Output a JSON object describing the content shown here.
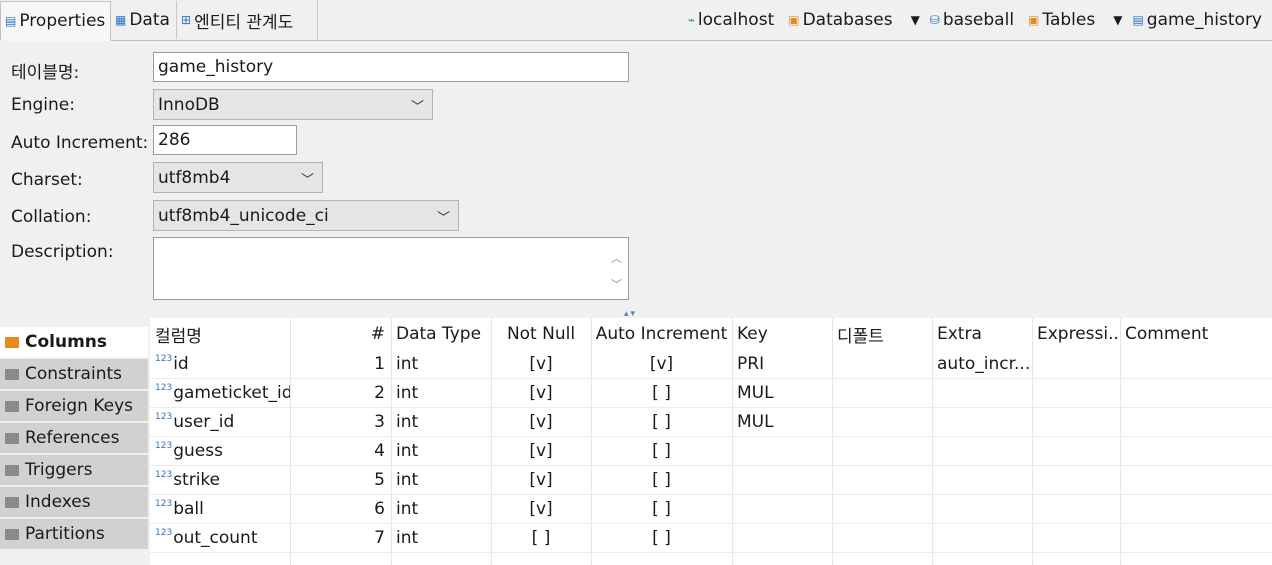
{
  "tabs": [
    {
      "label": "Properties",
      "icon": "properties-icon"
    },
    {
      "label": "Data",
      "icon": "data-icon"
    },
    {
      "label": "엔티티 관계도",
      "icon": "er-diagram-icon"
    }
  ],
  "breadcrumb": {
    "host": "localhost",
    "databases": "Databases",
    "database": "baseball",
    "tables": "Tables",
    "table": "game_history"
  },
  "form": {
    "table_name_label": "테이블명:",
    "table_name_value": "game_history",
    "engine_label": "Engine:",
    "engine_value": "InnoDB",
    "auto_increment_label": "Auto Increment:",
    "auto_increment_value": "286",
    "charset_label": "Charset:",
    "charset_value": "utf8mb4",
    "collation_label": "Collation:",
    "collation_value": "utf8mb4_unicode_ci",
    "description_label": "Description:",
    "description_value": ""
  },
  "sidenav": [
    "Columns",
    "Constraints",
    "Foreign Keys",
    "References",
    "Triggers",
    "Indexes",
    "Partitions"
  ],
  "columns_table": {
    "headers": [
      "컬럼명",
      "#",
      "Data Type",
      "Not Null",
      "Auto Increment",
      "Key",
      "디폴트",
      "Extra",
      "Expressi...",
      "Comment"
    ],
    "rows": [
      {
        "name": "id",
        "num": "1",
        "type": "int",
        "not_null": "[v]",
        "auto_inc": "[v]",
        "key": "PRI",
        "default": "",
        "extra": "auto_incr...",
        "expr": "",
        "comment": ""
      },
      {
        "name": "gameticket_id",
        "num": "2",
        "type": "int",
        "not_null": "[v]",
        "auto_inc": "[ ]",
        "key": "MUL",
        "default": "",
        "extra": "",
        "expr": "",
        "comment": ""
      },
      {
        "name": "user_id",
        "num": "3",
        "type": "int",
        "not_null": "[v]",
        "auto_inc": "[ ]",
        "key": "MUL",
        "default": "",
        "extra": "",
        "expr": "",
        "comment": ""
      },
      {
        "name": "guess",
        "num": "4",
        "type": "int",
        "not_null": "[v]",
        "auto_inc": "[ ]",
        "key": "",
        "default": "",
        "extra": "",
        "expr": "",
        "comment": ""
      },
      {
        "name": "strike",
        "num": "5",
        "type": "int",
        "not_null": "[v]",
        "auto_inc": "[ ]",
        "key": "",
        "default": "",
        "extra": "",
        "expr": "",
        "comment": ""
      },
      {
        "name": "ball",
        "num": "6",
        "type": "int",
        "not_null": "[v]",
        "auto_inc": "[ ]",
        "key": "",
        "default": "",
        "extra": "",
        "expr": "",
        "comment": ""
      },
      {
        "name": "out_count",
        "num": "7",
        "type": "int",
        "not_null": "[ ]",
        "auto_inc": "[ ]",
        "key": "",
        "default": "",
        "extra": "",
        "expr": "",
        "comment": ""
      }
    ],
    "type_icon_text": "123"
  }
}
